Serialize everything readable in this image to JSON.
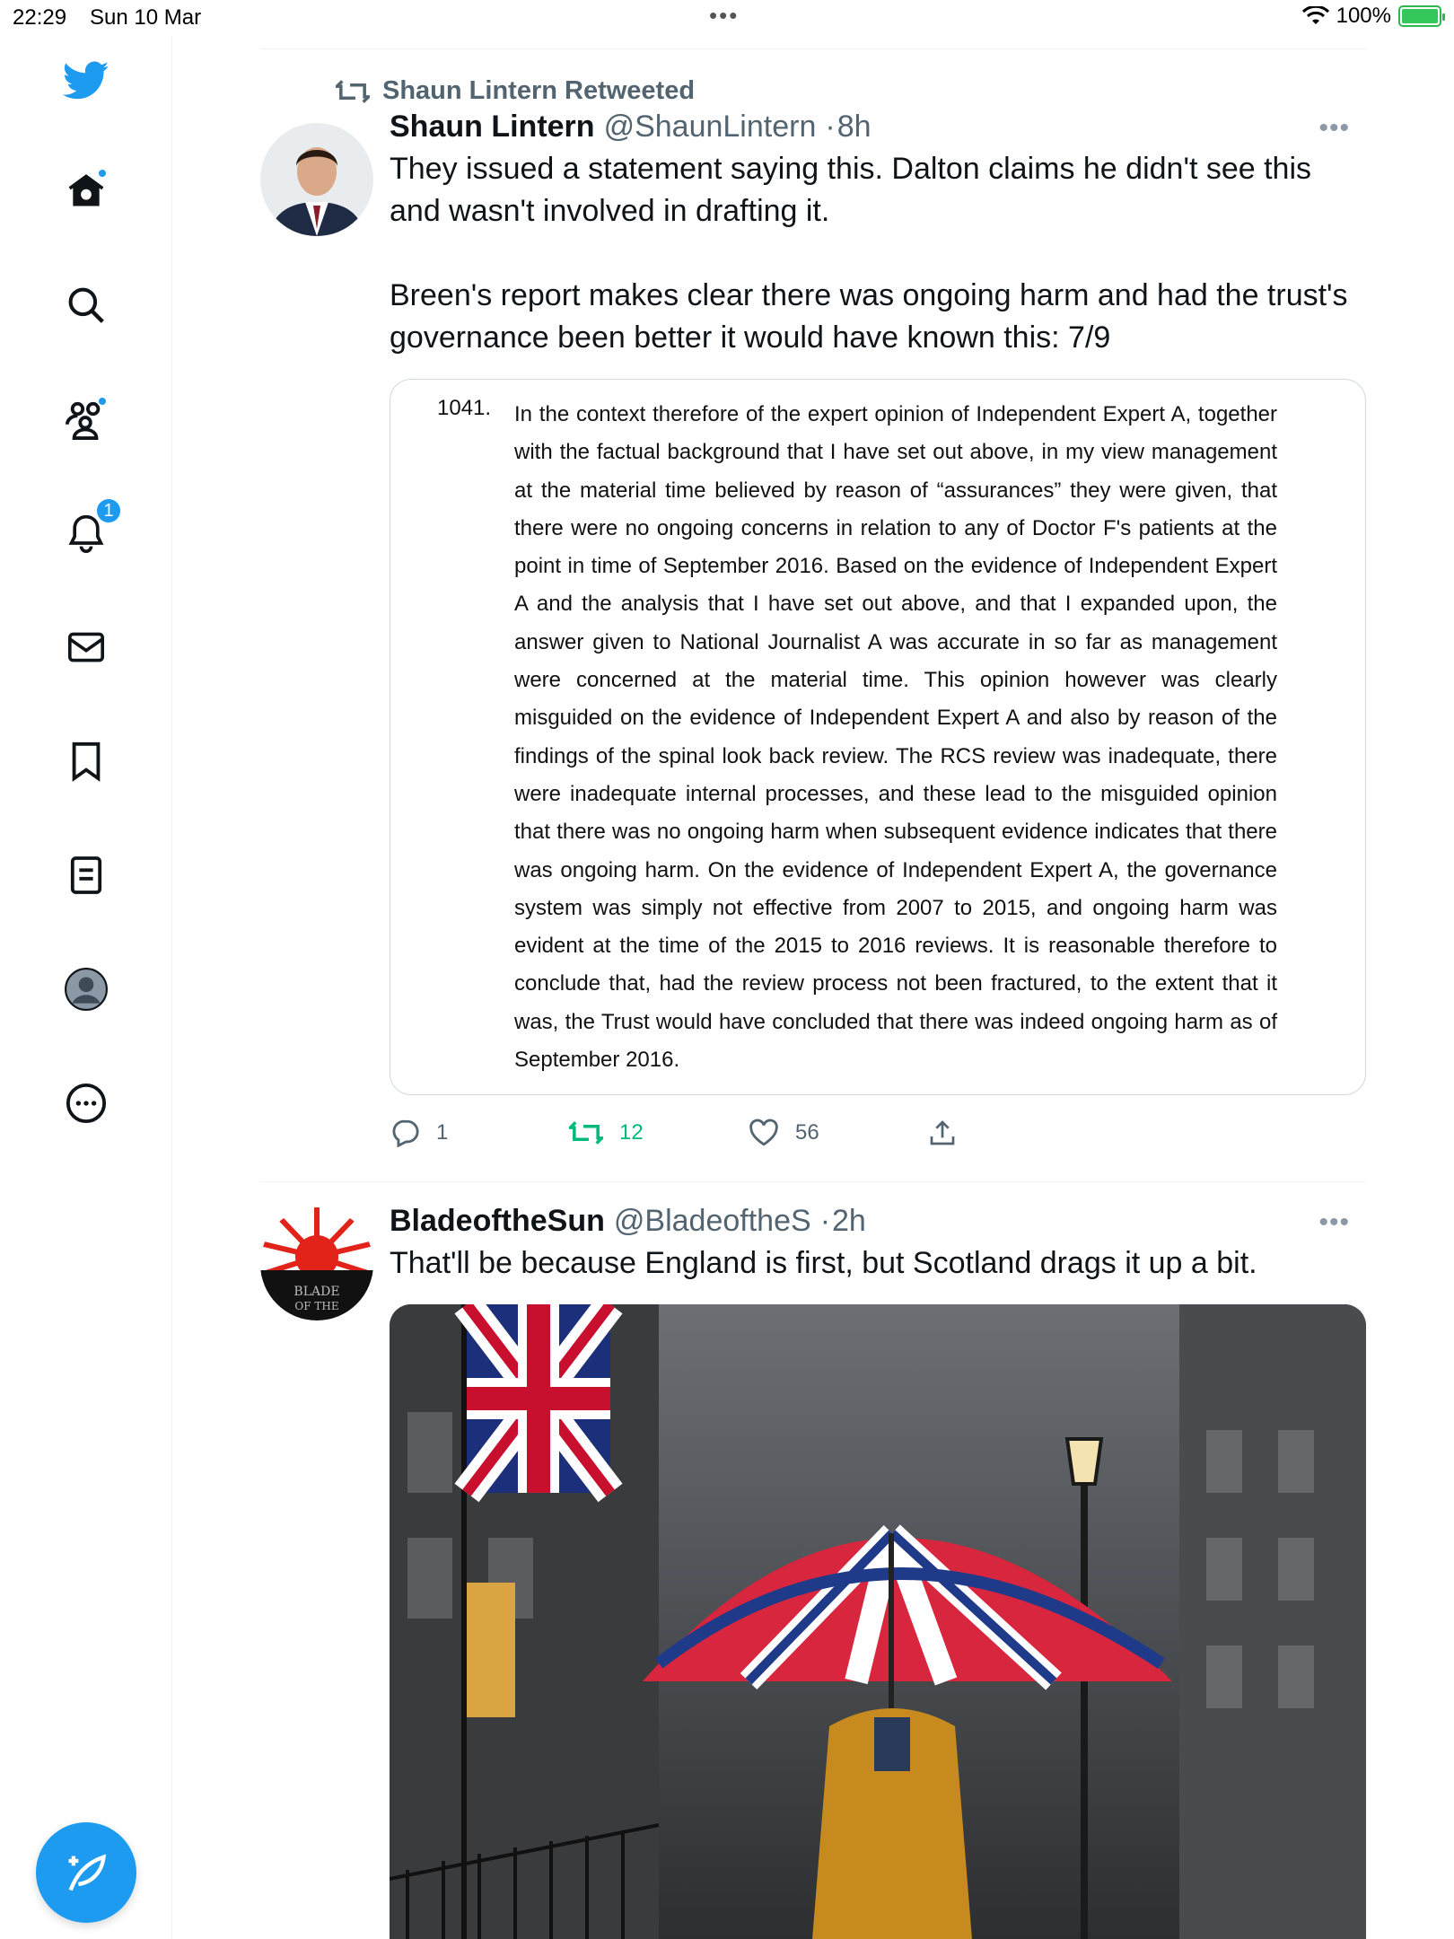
{
  "status_bar": {
    "time": "22:29",
    "date": "Sun 10 Mar",
    "dots": "•••",
    "battery_percent": "100%",
    "battery_level": 1.0
  },
  "sidebar": {
    "items": [
      {
        "name": "twitter-logo-icon"
      },
      {
        "name": "home-icon",
        "has_dot": true
      },
      {
        "name": "search-icon"
      },
      {
        "name": "communities-icon",
        "has_dot": true
      },
      {
        "name": "notifications-icon",
        "badge": "1"
      },
      {
        "name": "messages-icon"
      },
      {
        "name": "bookmarks-icon"
      },
      {
        "name": "lists-icon"
      },
      {
        "name": "profile-icon"
      },
      {
        "name": "more-icon"
      }
    ],
    "compose_icon": "compose-tweet-icon"
  },
  "tweets": [
    {
      "retweeted_by": "Shaun Lintern Retweeted",
      "author": "Shaun Lintern",
      "handle": "@ShaunLintern",
      "sep": "·",
      "time": "8h",
      "text": "They issued a statement saying this. Dalton claims he didn't see this and wasn't involved in drafting it.\n\nBreen's report makes clear there was ongoing harm and had the trust's governance been better it would have known this: 7/9",
      "document": {
        "number": "1041.",
        "text": "In the context therefore of the expert opinion of Independent Expert A, together with the factual background that I have set out above, in my view management at the material time believed by reason of “assurances” they were given, that there were no ongoing concerns in relation to any of Doctor F's patients at the point in time of September 2016. Based on the evidence of Independent Expert A and the analysis that I have set out above, and that I expanded upon, the answer given to National Journalist A was accurate in so far as management were concerned at the material time. This opinion however was clearly misguided on the evidence of Independent Expert A and also by reason of the findings of the spinal look back review. The RCS review was inadequate, there were inadequate internal processes, and these lead to the misguided opinion that there was no ongoing harm when subsequent evidence indicates that there was ongoing harm. On the evidence of Independent Expert A, the governance system was simply not effective from 2007 to 2015, and ongoing harm was evident at the time of the 2015 to 2016 reviews. It is reasonable therefore to conclude that, had the review process not been fractured, to the extent that it was, the Trust would have concluded that there was indeed ongoing harm as of September 2016."
      },
      "replies": "1",
      "retweets": "12",
      "likes": "56",
      "retweeted": true
    },
    {
      "author": "BladeoftheSun",
      "handle": "@BladeoftheS",
      "sep": "·",
      "time": "2h",
      "text": "That'll be because England is first, but Scotland drags it up a bit.",
      "avatar_text": "BLADE OF THE"
    }
  ],
  "colors": {
    "accent": "#1d9bf0",
    "retweet_green": "#00ba7c",
    "secondary_text": "#536471",
    "border": "#eff3f4"
  }
}
